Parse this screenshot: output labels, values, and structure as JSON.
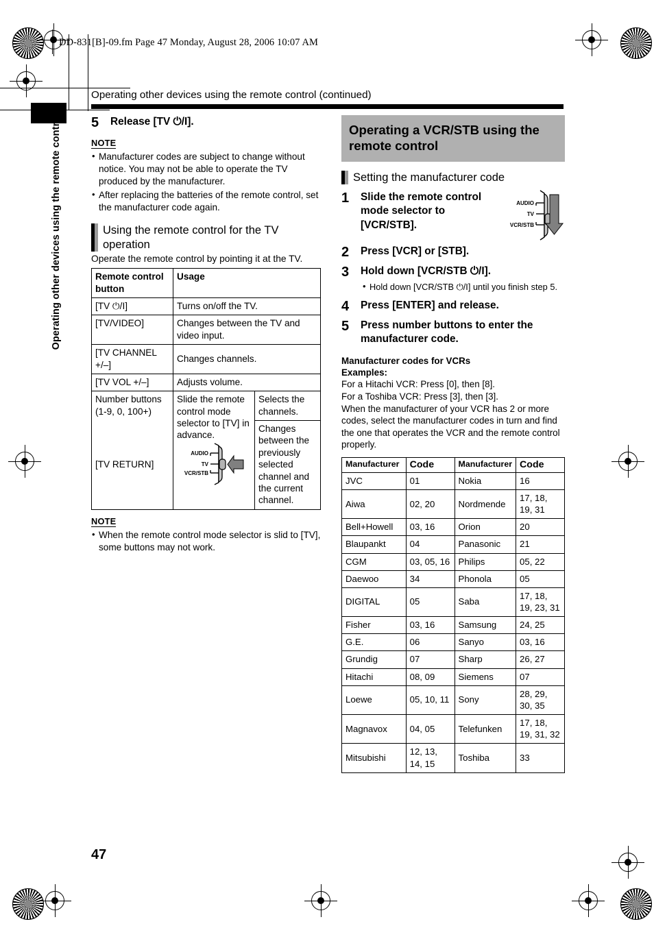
{
  "print_marks": {
    "file_info": "DD-831[B]-09.fm  Page 47  Monday, August 28, 2006  10:07 AM"
  },
  "sidebar": {
    "tab_label": "Operating other devices using the remote control"
  },
  "running_head": "Operating other devices using the remote control (continued)",
  "page_number": "47",
  "left_column": {
    "step5": {
      "number": "5",
      "text": "Release [TV ⏻/I]."
    },
    "note1": {
      "title": "NOTE",
      "items": [
        "Manufacturer codes are subject to change without notice. You may not be able to operate the TV produced by the manufacturer.",
        "After replacing the batteries of the remote control, set the manufacturer code again."
      ]
    },
    "section": {
      "title": "Using the remote control for the TV operation",
      "lead": "Operate the remote control by pointing it at the TV."
    },
    "tv_table": {
      "headers": [
        "Remote control button",
        "Usage"
      ],
      "rows": [
        {
          "button": "[TV ⏻/I]",
          "usage": "Turns on/off the TV."
        },
        {
          "button": "[TV/VIDEO]",
          "usage": "Changes between the TV and video input."
        },
        {
          "button": "[TV CHANNEL +/–]",
          "usage": "Changes channels."
        },
        {
          "button": "[TV VOL +/–]",
          "usage": "Adjusts volume."
        },
        {
          "button": "Number buttons (1-9, 0, 100+)",
          "usage": "Slide the remote control mode selector to [TV] in advance.",
          "usage2": "Selects the channels."
        },
        {
          "button": "[TV RETURN]",
          "usage": "",
          "usage2": "Changes between the previously selected channel and the current channel."
        }
      ]
    },
    "note2": {
      "title": "NOTE",
      "items": [
        "When the remote control mode selector is slid to [TV], some buttons may not work."
      ]
    }
  },
  "right_column": {
    "banner_title": "Operating a VCR/STB using the remote control",
    "section_title": "Setting the manufacturer code",
    "steps": [
      {
        "number": "1",
        "text": "Slide the remote control mode selector to [VCR/STB]."
      },
      {
        "number": "2",
        "text": "Press [VCR] or [STB]."
      },
      {
        "number": "3",
        "text": "Hold down [VCR/STB ⏻/I].",
        "bullets": [
          "Hold down [VCR/STB ⏻/I] until you finish step 5."
        ]
      },
      {
        "number": "4",
        "text": "Press [ENTER] and release."
      },
      {
        "number": "5",
        "text": "Press number buttons to enter the manufacturer code."
      }
    ],
    "codes_heading_line1": "Manufacturer codes for VCRs",
    "codes_heading_line2": "Examples:",
    "codes_intro": [
      "For a Hitachi VCR: Press [0], then [8].",
      "For a Toshiba VCR: Press [3], then [3].",
      "When the manufacturer of your VCR has 2 or more codes, select the manufacturer codes in turn and find the one that operates the VCR and the remote control properly."
    ],
    "code_table": {
      "headers": [
        "Manufacturer",
        "Code",
        "Manufacturer",
        "Code"
      ],
      "rows": [
        [
          "JVC",
          "01",
          "Nokia",
          "16"
        ],
        [
          "Aiwa",
          "02, 20",
          "Nordmende",
          "17, 18, 19, 31"
        ],
        [
          "Bell+Howell",
          "03, 16",
          "Orion",
          "20"
        ],
        [
          "Blaupankt",
          "04",
          "Panasonic",
          "21"
        ],
        [
          "CGM",
          "03, 05, 16",
          "Philips",
          "05, 22"
        ],
        [
          "Daewoo",
          "34",
          "Phonola",
          "05"
        ],
        [
          "DIGITAL",
          "05",
          "Saba",
          "17, 18, 19, 23, 31"
        ],
        [
          "Fisher",
          "03, 16",
          "Samsung",
          "24, 25"
        ],
        [
          "G.E.",
          "06",
          "Sanyo",
          "03, 16"
        ],
        [
          "Grundig",
          "07",
          "Sharp",
          "26, 27"
        ],
        [
          "Hitachi",
          "08, 09",
          "Siemens",
          "07"
        ],
        [
          "Loewe",
          "05, 10, 11",
          "Sony",
          "28, 29, 30, 35"
        ],
        [
          "Magnavox",
          "04, 05",
          "Telefunken",
          "17, 18, 19, 31, 32"
        ],
        [
          "Mitsubishi",
          "12, 13, 14, 15",
          "Toshiba",
          "33"
        ]
      ]
    }
  },
  "switch_diagram": {
    "labels": [
      "AUDIO",
      "TV",
      "VCR/STB"
    ],
    "left_arrow_points_to": "TV",
    "right_arrow_points_to": "VCR/STB"
  },
  "colors": {
    "banner_gray": "#b0b0b0",
    "switch_gray": "#a8a8a8",
    "arrow_gray": "#7a7a7a"
  }
}
